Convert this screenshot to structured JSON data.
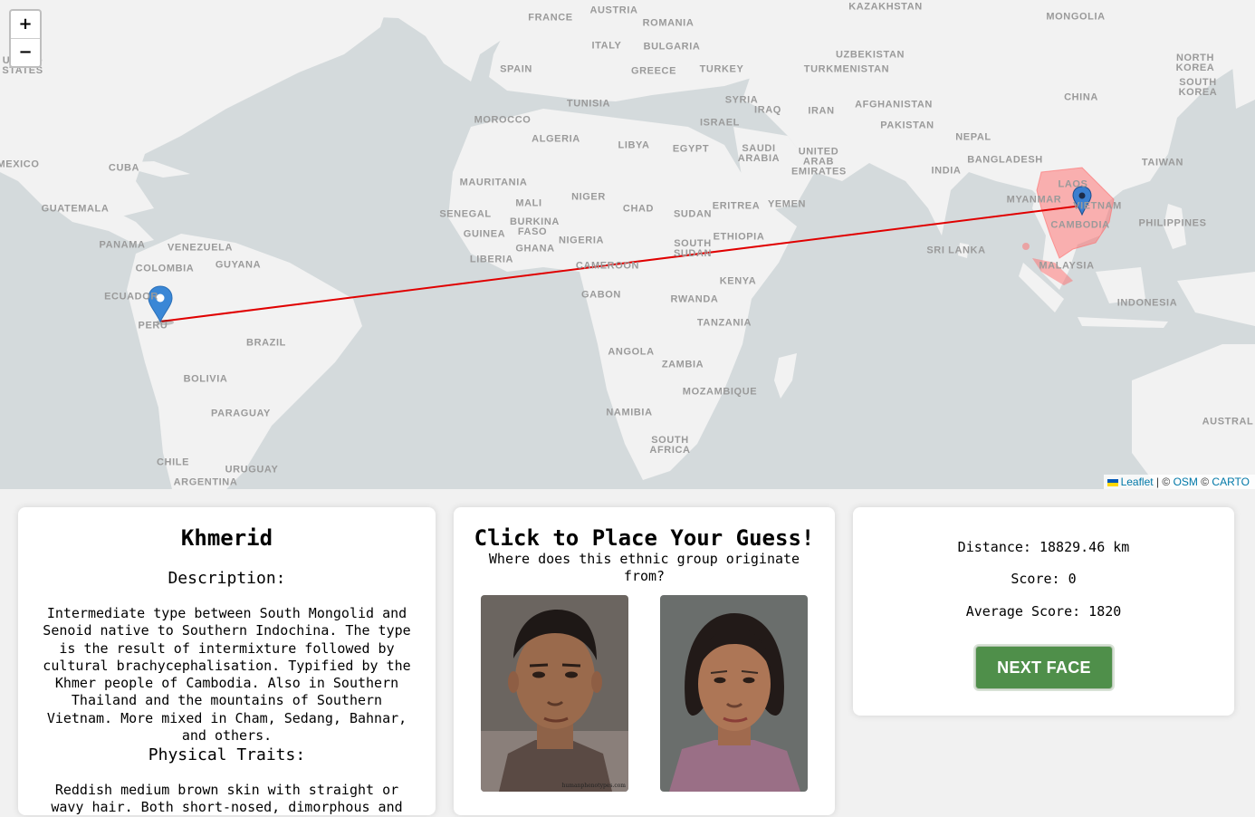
{
  "map": {
    "zoom_in": "+",
    "zoom_out": "−",
    "labels": [
      "FRANCE",
      "AUSTRIA",
      "ROMANIA",
      "BULGARIA",
      "ITALY",
      "SPAIN",
      "GREECE",
      "TURKEY",
      "KAZAKHSTAN",
      "MONGOLIA",
      "NORTH KOREA",
      "SOUTH KOREA",
      "UZBEKISTAN",
      "TURKMENISTAN",
      "CHINA",
      "SYRIA",
      "IRAQ",
      "IRAN",
      "AFGHANISTAN",
      "PAKISTAN",
      "TUNISIA",
      "MOROCCO",
      "ISRAEL",
      "ALGERIA",
      "LIBYA",
      "EGYPT",
      "SAUDI ARABIA",
      "UNITED ARAB EMIRATES",
      "NEPAL",
      "BANGLADESH",
      "TAIWAN",
      "INDIA",
      "MEXICO",
      "CUBA",
      "MAURITANIA",
      "MALI",
      "NIGER",
      "CHAD",
      "SUDAN",
      "ERITREA",
      "YEMEN",
      "MYANMAR",
      "LAOS",
      "VIETNAM",
      "CAMBODIA",
      "PHILIPPINES",
      "GUATEMALA",
      "SENEGAL",
      "BURKINA FASO",
      "GUINEA",
      "GHANA",
      "NIGERIA",
      "ETHIOPIA",
      "SOUTH SUDAN",
      "SRI LANKA",
      "MALAYSIA",
      "PANAMA",
      "VENEZUELA",
      "GUYANA",
      "COLOMBIA",
      "LIBERIA",
      "CAMEROON",
      "KENYA",
      "ECUADOR",
      "GABON",
      "RWANDA",
      "INDONESIA",
      "TANZANIA",
      "PERU",
      "BRAZIL",
      "ANGOLA",
      "ZAMBIA",
      "BOLIVIA",
      "MOZAMBIQUE",
      "PARAGUAY",
      "NAMIBIA",
      "AUSTRAL",
      "SOUTH AFRICA",
      "CHILE",
      "URUGUAY",
      "ARGENTINA",
      "UNITED STATES"
    ],
    "attribution": {
      "leaflet": "Leaflet",
      "sep1": " | © ",
      "osm": "OSM",
      "sep2": " © ",
      "carto": "CARTO"
    },
    "guess_marker": {
      "label": "PERU",
      "color": "#3a87d6"
    },
    "answer_marker": {
      "label": "CAMBODIA",
      "color": "#3a7fd0"
    },
    "line_color": "#e00000",
    "region_color": "#ff6b6b"
  },
  "info": {
    "title": "Khmerid",
    "description_heading": "Description:",
    "description": "Intermediate type between South Mongolid and Senoid native to Southern Indochina. The type is the result of intermixture followed by cultural brachycephalisation. Typified by the Khmer people of Cambodia. Also in Southern Thailand and the mountains of Southern Vietnam. More mixed in Cham, Sedang, Bahnar, and others.",
    "traits_heading": "Physical Traits:",
    "traits": "Reddish medium brown skin with straight or wavy hair. Both short-nosed, dimorphous and"
  },
  "guess": {
    "title": "Click to Place Your Guess!",
    "subtitle": "Where does this ethnic group originate from?",
    "faces": [
      "male-face",
      "female-face"
    ],
    "watermark": "humanphenotypes.com"
  },
  "score": {
    "distance_label": "Distance:",
    "distance_value": "18829.46 km",
    "score_label": "Score:",
    "score_value": "0",
    "avg_label": "Average Score:",
    "avg_value": "1820",
    "next_button": "NEXT FACE"
  }
}
